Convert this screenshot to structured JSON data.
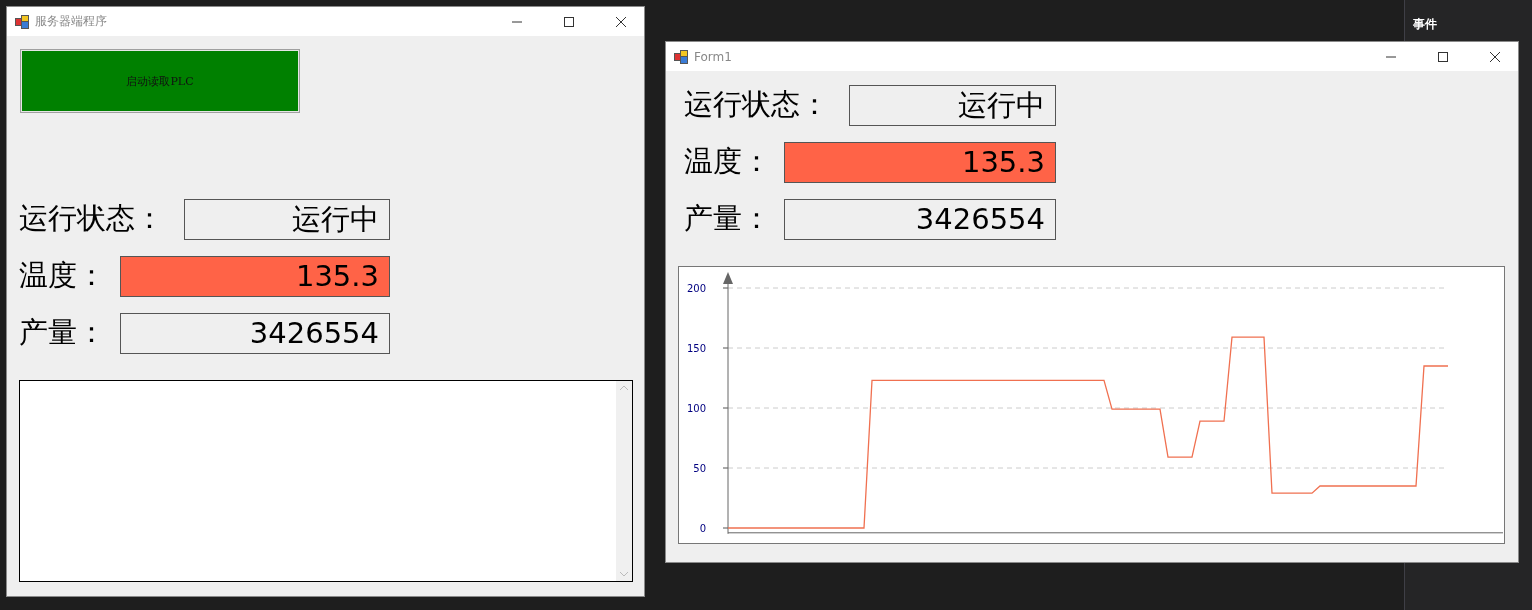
{
  "side_panel": {
    "header": "事件"
  },
  "windows": [
    {
      "kind": "server",
      "title": "服务器端程序",
      "start_button": "启动读取PLC",
      "fields": [
        {
          "label": "运行状态：",
          "value": "运行中",
          "color": "#efefef"
        },
        {
          "label": "温度：",
          "value": "135.3",
          "color": "#ff6347"
        },
        {
          "label": "产量：",
          "value": "3426554",
          "color": "#efefef"
        }
      ]
    },
    {
      "kind": "monitor",
      "title": "Form1",
      "fields": [
        {
          "label": "运行状态：",
          "value": "运行中",
          "color": "#efefef"
        },
        {
          "label": "温度：",
          "value": "135.3",
          "color": "#ff6347"
        },
        {
          "label": "产量：",
          "value": "3426554",
          "color": "#efefef"
        }
      ],
      "chart_data": {
        "type": "line",
        "grid": true,
        "ylim": [
          -4,
          200
        ],
        "yticks": [
          0,
          50,
          100,
          150,
          200
        ],
        "categories": [
          null,
          null,
          null,
          null,
          null,
          null,
          null,
          null,
          null,
          null,
          null,
          null,
          null,
          null,
          null,
          null,
          null,
          null,
          null,
          null,
          null,
          null,
          null,
          null,
          null,
          null,
          null,
          null,
          null,
          null,
          null,
          null,
          null,
          null,
          null,
          null,
          null,
          null,
          null,
          null,
          null,
          null,
          null,
          null,
          null,
          null,
          null,
          null,
          null,
          null,
          null,
          null,
          null,
          null,
          null,
          null,
          null,
          null,
          null,
          null,
          null,
          null,
          null,
          null,
          null,
          null,
          null,
          null,
          null,
          null,
          null,
          null,
          null,
          null,
          null,
          null,
          null,
          null,
          null,
          null,
          null,
          null,
          null,
          null,
          null,
          null,
          null,
          null,
          null,
          null,
          null
        ],
        "series": [
          {
            "color": "#f07050",
            "values": [
              0,
              0,
              0,
              0,
              0,
              0,
              0,
              0,
              0,
              0,
              0,
              0,
              0,
              0,
              0,
              0,
              0,
              0,
              123,
              123,
              123,
              123,
              123,
              123,
              123,
              123,
              123,
              123,
              123,
              123,
              123,
              123,
              123,
              123,
              123,
              123,
              123,
              123,
              123,
              123,
              123,
              123,
              123,
              123,
              123,
              123,
              123,
              123,
              99,
              99,
              99,
              99,
              99,
              99,
              99,
              59,
              59,
              59,
              59,
              89,
              89,
              89,
              89,
              159,
              159,
              159,
              159,
              159,
              29,
              29,
              29,
              29,
              29,
              29,
              35,
              35,
              35,
              35,
              35,
              35,
              35,
              35,
              35,
              35,
              35,
              35,
              35,
              135,
              135,
              135,
              135
            ]
          }
        ]
      }
    }
  ]
}
